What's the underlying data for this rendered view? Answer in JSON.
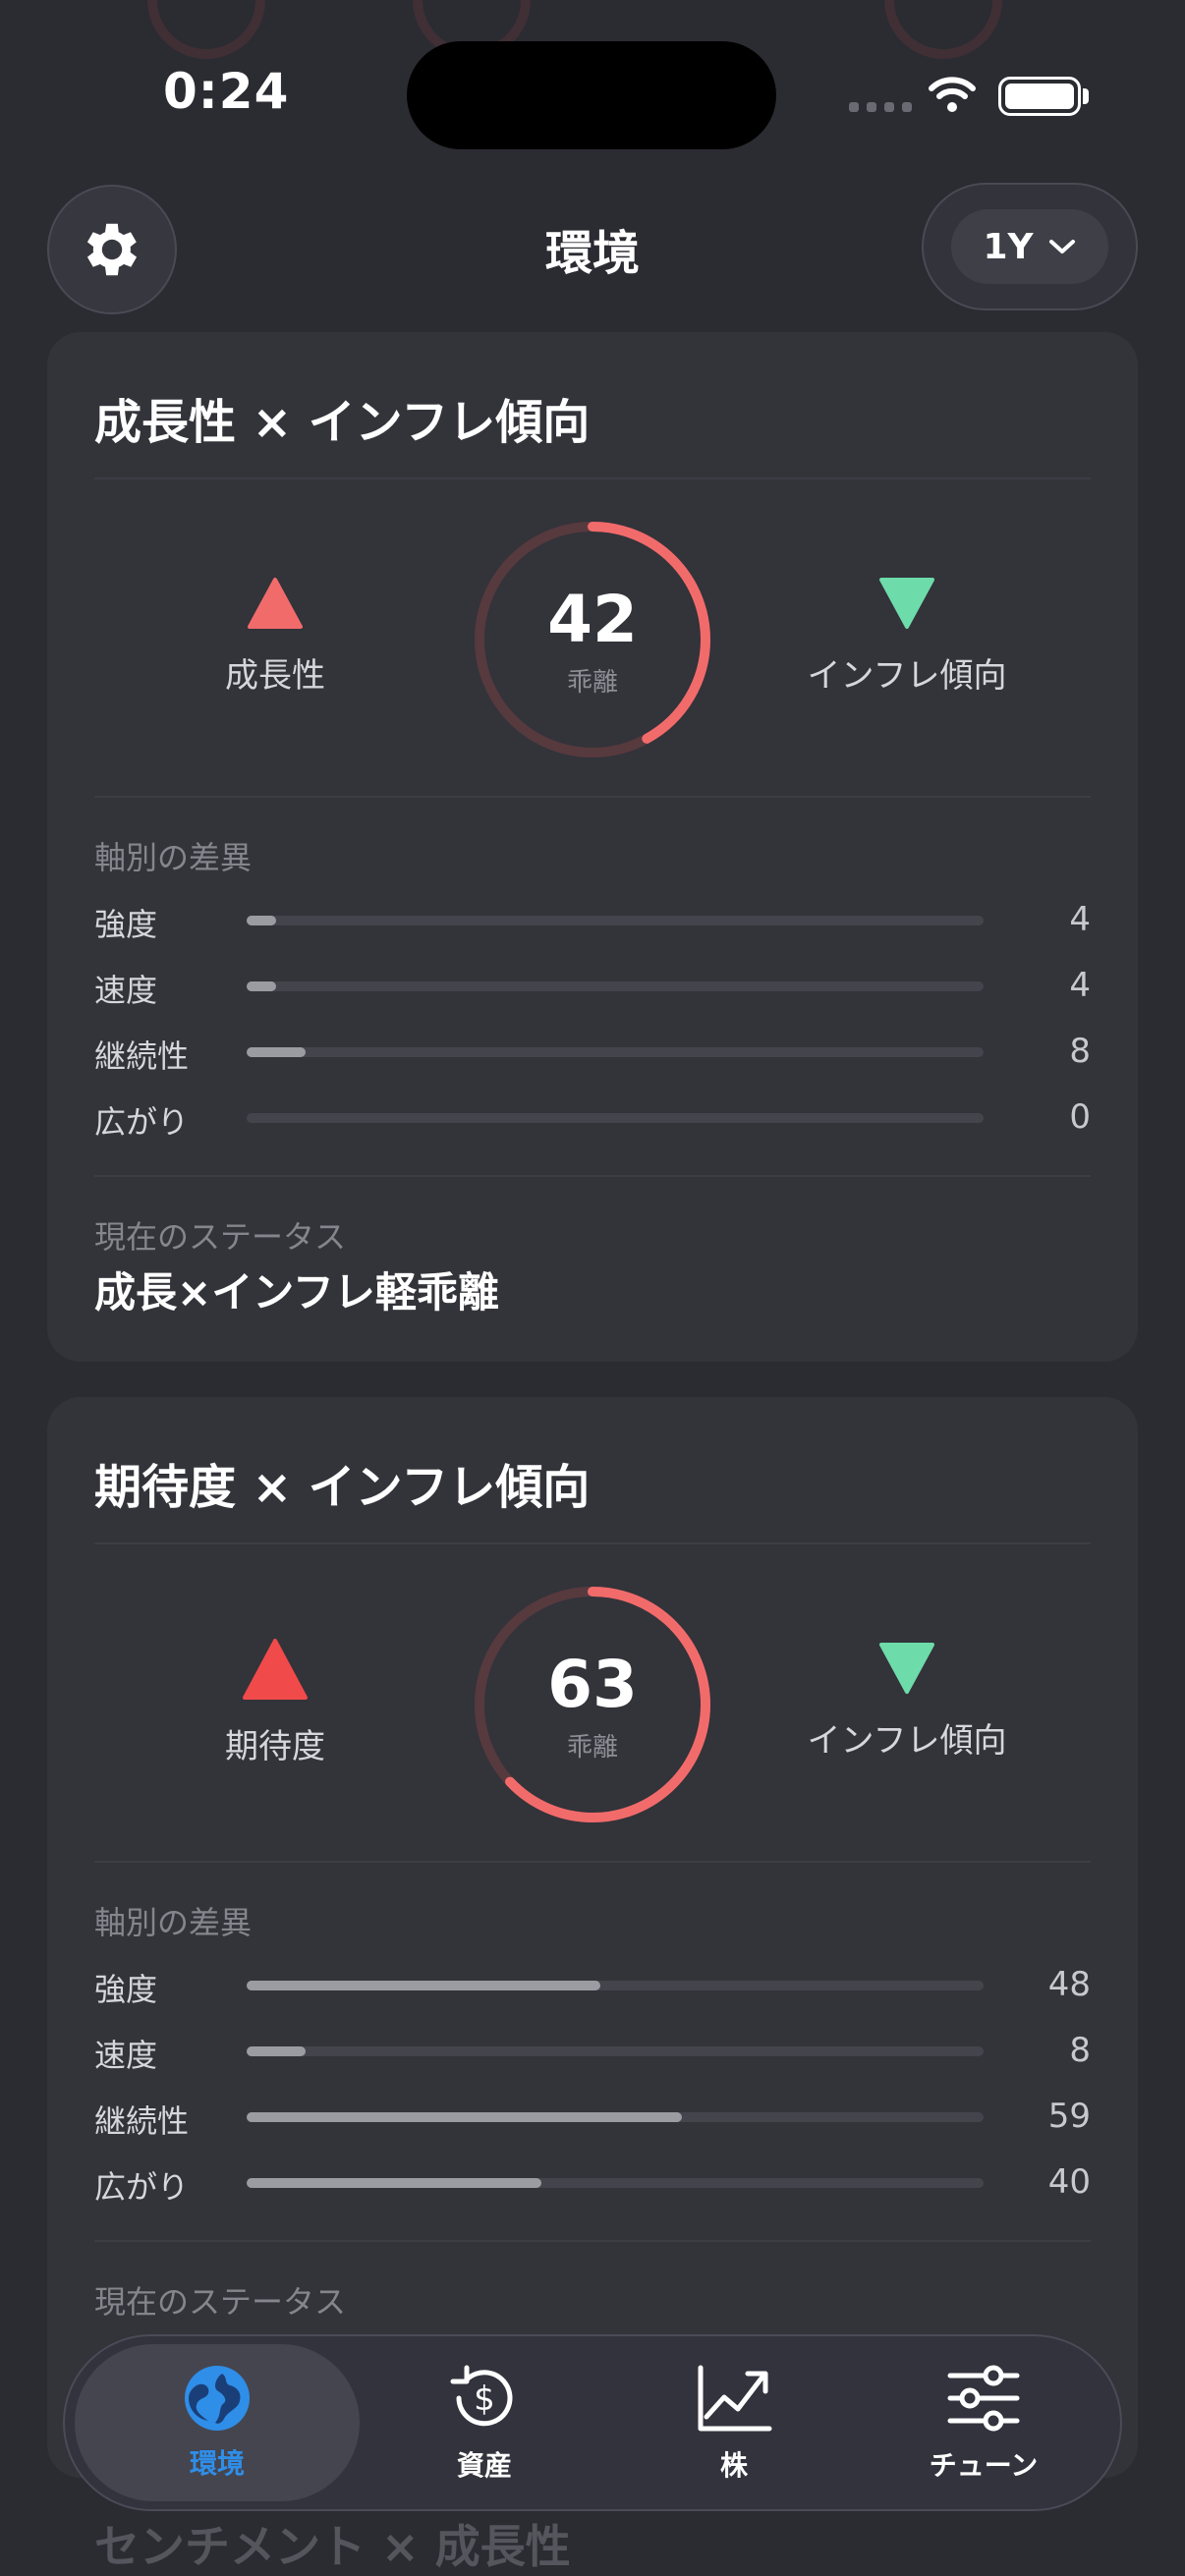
{
  "status_bar": {
    "time": "0:24"
  },
  "header": {
    "title": "環境",
    "range_label": "1Y"
  },
  "cards": [
    {
      "title": "成長性 × インフレ傾向",
      "left_label": "成長性",
      "left_color": "#f26b6b",
      "score": "42",
      "score_sub": "乖離",
      "score_fraction": 0.42,
      "right_label": "インフレ傾向",
      "right_color": "#6ddcaa",
      "section_label": "軸別の差異",
      "rows": [
        {
          "label": "強度",
          "value": "4",
          "fraction": 0.04
        },
        {
          "label": "速度",
          "value": "4",
          "fraction": 0.04
        },
        {
          "label": "継続性",
          "value": "8",
          "fraction": 0.08
        },
        {
          "label": "広がり",
          "value": "0",
          "fraction": 0.0
        }
      ],
      "status_label": "現在のステータス",
      "status_value": "成長×インフレ軽乖離"
    },
    {
      "title": "期待度 × インフレ傾向",
      "left_label": "期待度",
      "left_color": "#f04a4a",
      "score": "63",
      "score_sub": "乖離",
      "score_fraction": 0.63,
      "right_label": "インフレ傾向",
      "right_color": "#6ddcaa",
      "section_label": "軸別の差異",
      "rows": [
        {
          "label": "強度",
          "value": "48",
          "fraction": 0.48
        },
        {
          "label": "速度",
          "value": "8",
          "fraction": 0.08
        },
        {
          "label": "継続性",
          "value": "59",
          "fraction": 0.59
        },
        {
          "label": "広がり",
          "value": "40",
          "fraction": 0.4
        }
      ],
      "status_label": "現在のステータス"
    }
  ],
  "next_card_title": "センチメント × 成長性",
  "tabbar": [
    {
      "label": "環境",
      "icon": "globe-icon",
      "active": true
    },
    {
      "label": "資産",
      "icon": "dollar-cycle-icon",
      "active": false
    },
    {
      "label": "株",
      "icon": "chart-up-icon",
      "active": false
    },
    {
      "label": "チューン",
      "icon": "sliders-icon",
      "active": false
    }
  ],
  "colors": {
    "accent": "#2f8ee8",
    "ring": "#f26b6b",
    "background": "#2b2b32",
    "card": "#33333a"
  }
}
